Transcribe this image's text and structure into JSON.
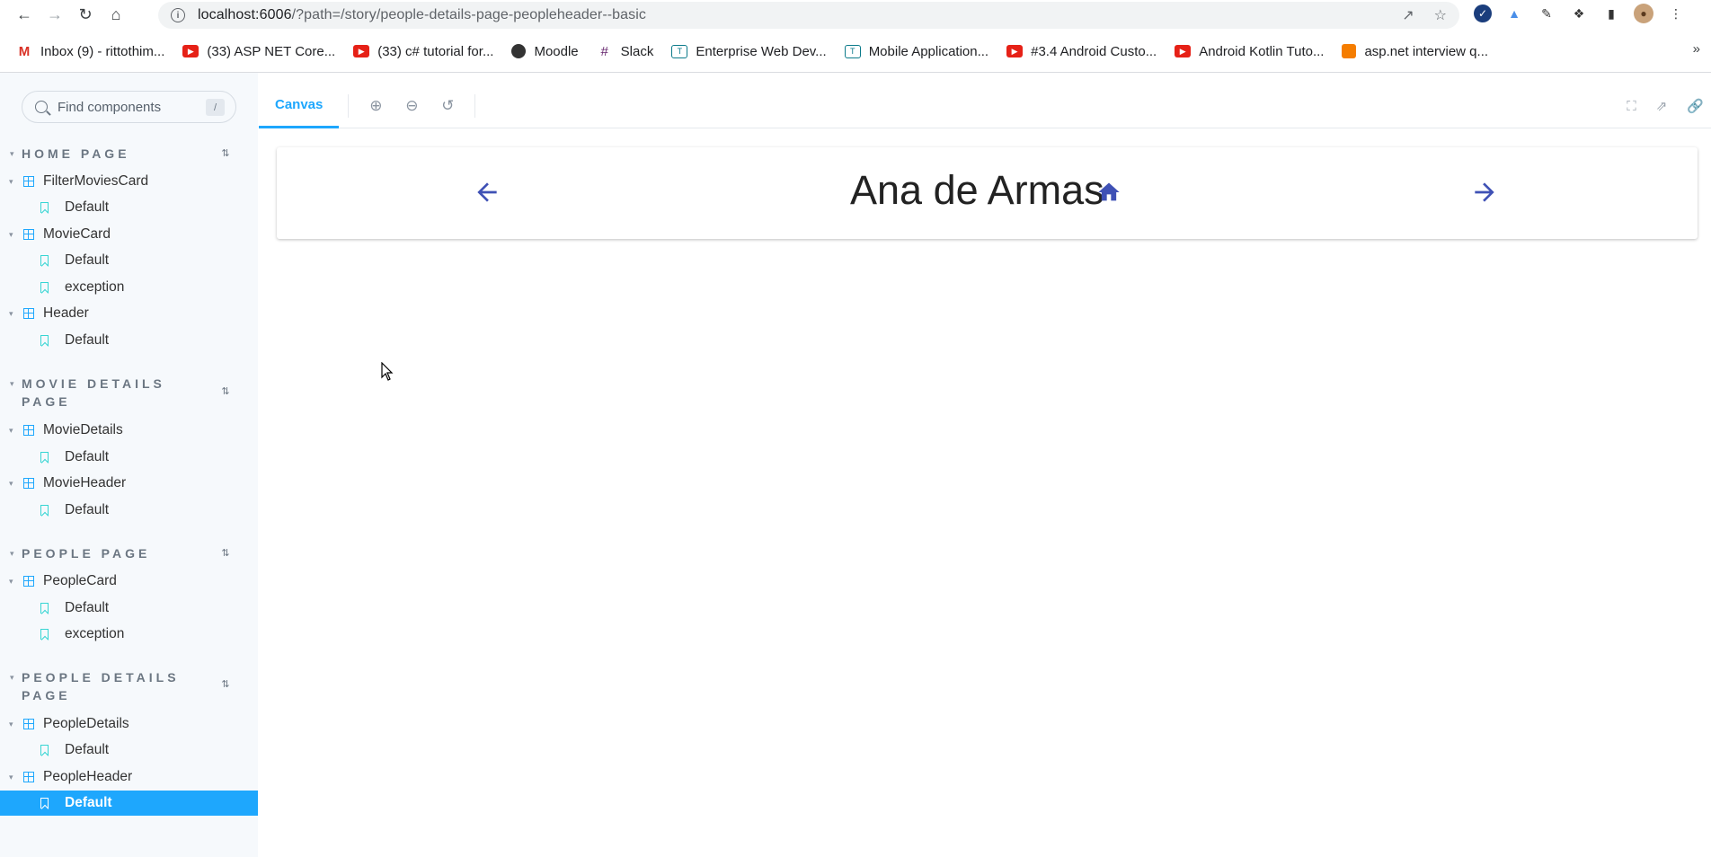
{
  "browser": {
    "url_host": "localhost:6006",
    "url_path": "/?path=/story/people-details-page-peopleheader--basic",
    "bookmarks": [
      {
        "icon": "gmail-icon",
        "label": "Inbox (9) - rittothim..."
      },
      {
        "icon": "youtube-icon",
        "label": "(33) ASP NET Core..."
      },
      {
        "icon": "youtube-icon",
        "label": "(33) c# tutorial for..."
      },
      {
        "icon": "moodle-icon",
        "label": "Moodle"
      },
      {
        "icon": "slack-icon",
        "label": "Slack"
      },
      {
        "icon": "teams-icon",
        "label": "Enterprise Web Dev..."
      },
      {
        "icon": "teams-icon",
        "label": "Mobile Application..."
      },
      {
        "icon": "youtube-icon",
        "label": "#3.4 Android Custo..."
      },
      {
        "icon": "youtube-icon",
        "label": "Android Kotlin Tuto..."
      },
      {
        "icon": "blogger-icon",
        "label": "asp.net interview q..."
      }
    ],
    "more_bookmarks": "»"
  },
  "sidebar": {
    "search_placeholder": "Find components",
    "search_shortcut": "/",
    "groups": [
      {
        "title": "HOME PAGE"
      },
      {
        "title": "MOVIE DETAILS PAGE"
      },
      {
        "title": "PEOPLE PAGE"
      },
      {
        "title": "PEOPLE DETAILS PAGE"
      }
    ],
    "components": [
      {
        "label": "FilterMoviesCard"
      },
      {
        "label": "MovieCard"
      },
      {
        "label": "Header"
      },
      {
        "label": "MovieDetails"
      },
      {
        "label": "MovieHeader"
      },
      {
        "label": "PeopleCard"
      },
      {
        "label": "PeopleDetails"
      },
      {
        "label": "PeopleHeader"
      }
    ],
    "stories": [
      {
        "label": "Default"
      },
      {
        "label": "Default"
      },
      {
        "label": "exception"
      },
      {
        "label": "Default"
      },
      {
        "label": "Default"
      },
      {
        "label": "Default"
      },
      {
        "label": "Default"
      },
      {
        "label": "exception"
      },
      {
        "label": "Default"
      },
      {
        "label": "Default"
      }
    ]
  },
  "toolbar": {
    "canvas_tab": "Canvas"
  },
  "preview": {
    "person_name": "Ana de Armas"
  },
  "colors": {
    "accent": "#1ea7fd",
    "story_icon": "#37d5d3",
    "header_icons": "#3f51b5"
  }
}
